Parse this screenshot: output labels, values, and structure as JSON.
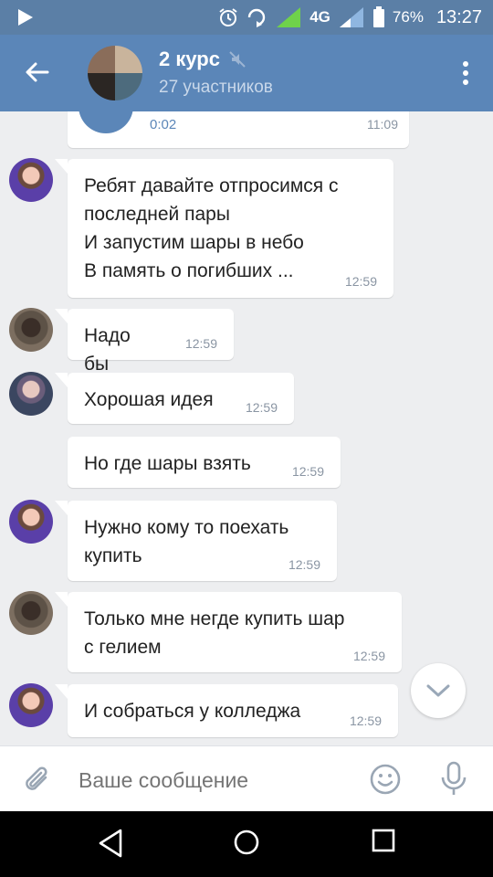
{
  "status_bar": {
    "battery": "76%",
    "time": "13:27",
    "network": "4G"
  },
  "header": {
    "title": "2 курс",
    "subtitle": "27 участников"
  },
  "voice_message": {
    "duration": "0:02",
    "time": "11:09"
  },
  "messages": [
    {
      "text": "Ребят давайте отпросимся с\nпоследней пары\nИ запустим шары в небо\nВ память о погибших ...",
      "time": "12:59"
    },
    {
      "text": "Надо бы",
      "time": "12:59"
    },
    {
      "text": "Хорошая идея",
      "time": "12:59"
    },
    {
      "text": "Но где шары взять",
      "time": "12:59"
    },
    {
      "text": "Нужно кому то поехать\nкупить",
      "time": "12:59"
    },
    {
      "text": "Только мне негде купить шар\nс гелием",
      "time": "12:59"
    },
    {
      "text": "И собраться у колледжа",
      "time": "12:59"
    }
  ],
  "input": {
    "placeholder": "Ваше сообщение"
  },
  "colors": {
    "header": "#5b86b8",
    "status_bar": "#5b7fa6",
    "background": "#edeef0"
  }
}
